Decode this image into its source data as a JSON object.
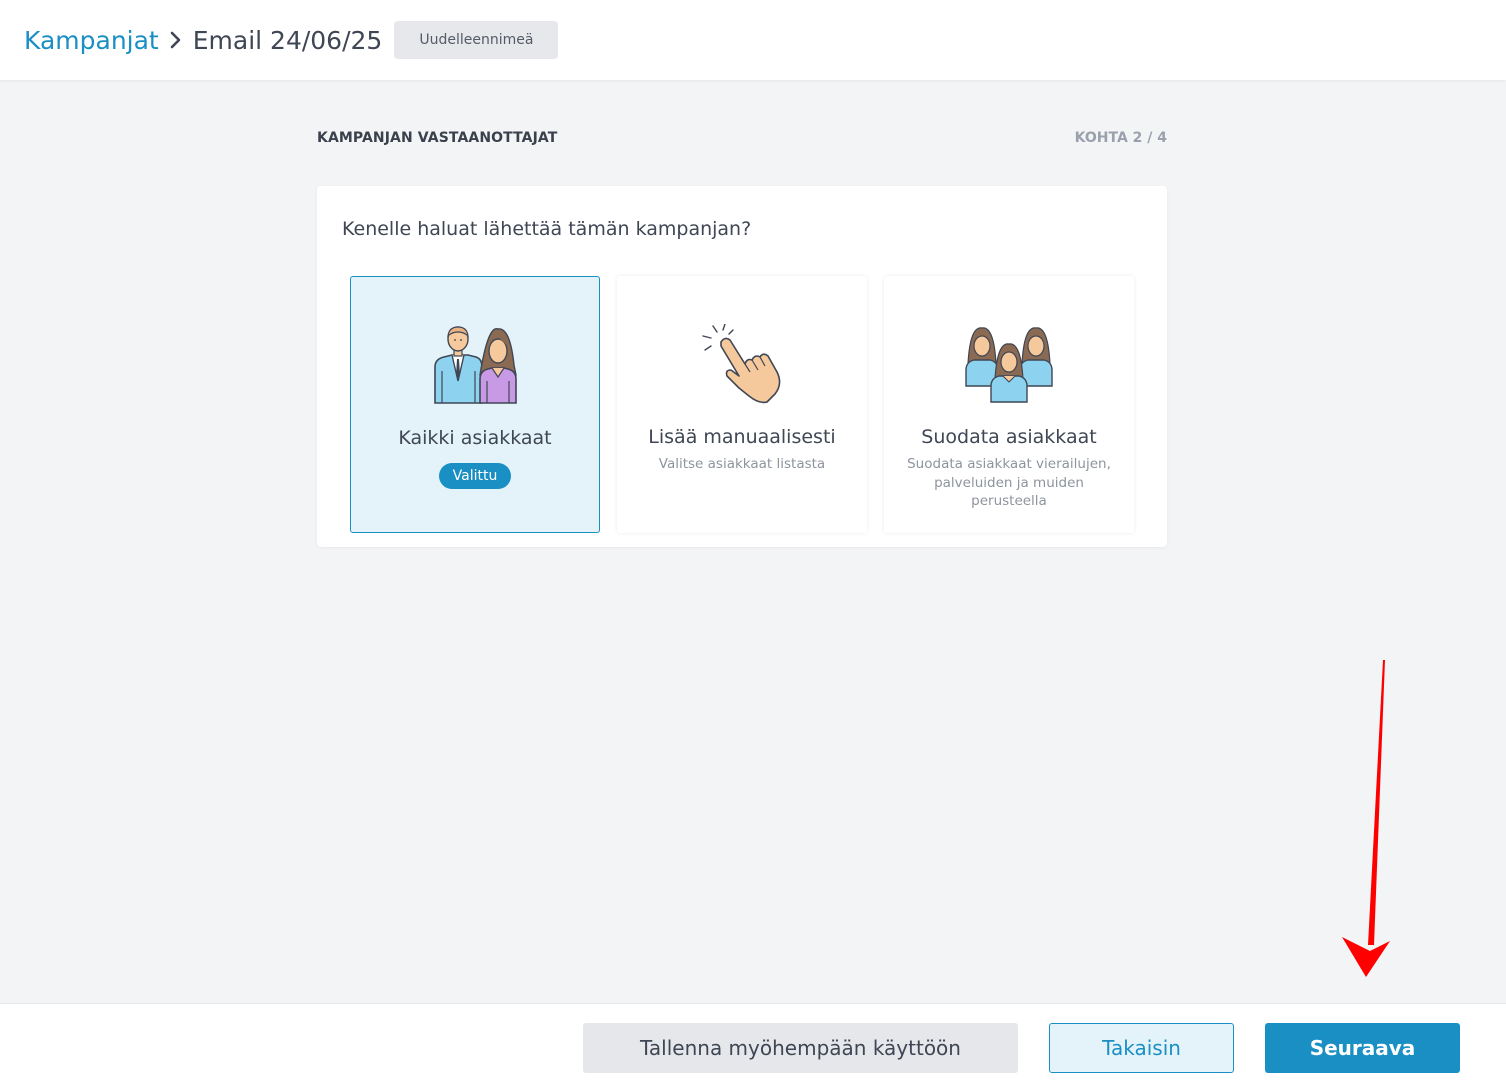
{
  "header": {
    "breadcrumb_root": "Kampanjat",
    "breadcrumb_current": "Email 24/06/25",
    "rename_label": "Uudelleennimeä"
  },
  "section": {
    "title": "KAMPANJAN VASTAANOTTAJAT",
    "step": "KOHTA 2 / 4"
  },
  "card": {
    "question": "Kenelle haluat lähettää tämän kampanjan?",
    "options": [
      {
        "title": "Kaikki asiakkaat",
        "badge": "Valittu",
        "selected": true,
        "icon": "customers-icon"
      },
      {
        "title": "Lisää manuaalisesti",
        "desc": "Valitse asiakkaat listasta",
        "selected": false,
        "icon": "tap-hand-icon"
      },
      {
        "title": "Suodata asiakkaat",
        "desc": "Suodata asiakkaat vierailujen, palveluiden ja muiden perusteella",
        "selected": false,
        "icon": "group-icon"
      }
    ]
  },
  "footer": {
    "save_label": "Tallenna myöhempään käyttöön",
    "back_label": "Takaisin",
    "next_label": "Seuraava"
  },
  "colors": {
    "accent": "#1a8fc4",
    "selected_bg": "#e4f3fa",
    "annotation_arrow": "#ff0000"
  }
}
